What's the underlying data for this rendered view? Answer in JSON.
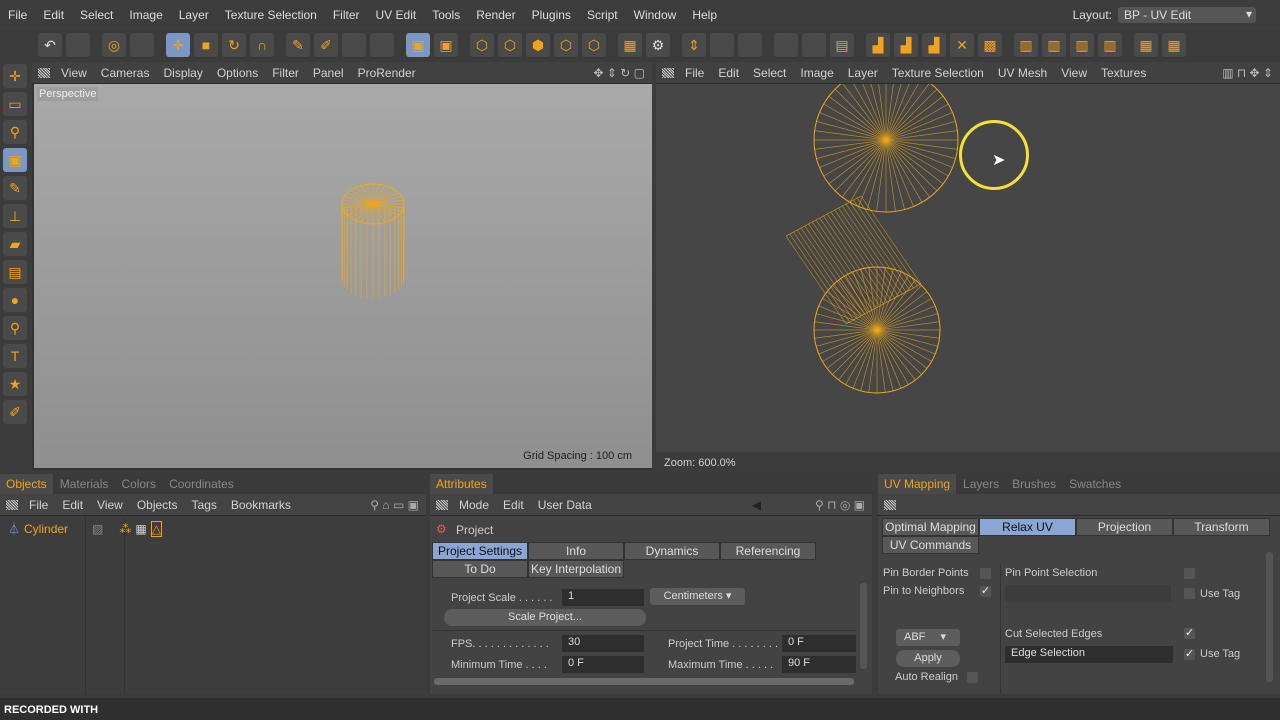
{
  "menu": [
    "File",
    "Edit",
    "Select",
    "Image",
    "Layer",
    "Texture Selection",
    "Filter",
    "UV Edit",
    "Tools",
    "Render",
    "Plugins",
    "Script",
    "Window",
    "Help"
  ],
  "layout": {
    "label": "Layout:",
    "value": "BP - UV Edit"
  },
  "viewport": {
    "menu": [
      "View",
      "Cameras",
      "Display",
      "Options",
      "Filter",
      "Panel",
      "ProRender"
    ],
    "name": "Perspective",
    "grid": "Grid Spacing : 100 cm"
  },
  "uv_view": {
    "menu": [
      "File",
      "Edit",
      "Select",
      "Image",
      "Layer",
      "Texture Selection",
      "UV Mesh",
      "View",
      "Textures"
    ],
    "zoom": "Zoom: 600.0%"
  },
  "objects_panel": {
    "tabs": [
      "Objects",
      "Materials",
      "Colors",
      "Coordinates"
    ],
    "menu": [
      "File",
      "Edit",
      "View",
      "Objects",
      "Tags",
      "Bookmarks"
    ],
    "object": "Cylinder"
  },
  "attributes": {
    "tab": "Attributes",
    "menu": [
      "Mode",
      "Edit",
      "User Data"
    ],
    "title": "Project",
    "tabs": [
      "Project Settings",
      "Info",
      "Dynamics",
      "Referencing",
      "To Do",
      "Key Interpolation"
    ],
    "project_scale_label": "Project Scale . . . . . .",
    "project_scale": "1",
    "units": "Centimeters",
    "scale_button": "Scale Project...",
    "fps_label": "FPS. . . . . . . . . . . . .",
    "fps": "30",
    "min_time_label": "Minimum Time . . . .",
    "min_time": "0 F",
    "project_time_label": "Project Time . . . . . . . .",
    "project_time": "0 F",
    "max_time_label": "Maximum Time . . . . .",
    "max_time": "90 F"
  },
  "uv_panel": {
    "tabs": [
      "UV Mapping",
      "Layers",
      "Brushes",
      "Swatches"
    ],
    "subtabs": [
      "Optimal Mapping",
      "Relax UV",
      "Projection",
      "Transform",
      "UV Commands"
    ],
    "pin_border": "Pin Border Points",
    "pin_neighbors": "Pin to Neighbors",
    "pin_point_sel": "Pin Point Selection",
    "use_tag": "Use Tag",
    "method": "ABF",
    "apply": "Apply",
    "auto_realign": "Auto Realign",
    "cut_edges": "Cut Selected Edges",
    "edge_sel": "Edge Selection"
  },
  "footer": "RECORDED WITH"
}
